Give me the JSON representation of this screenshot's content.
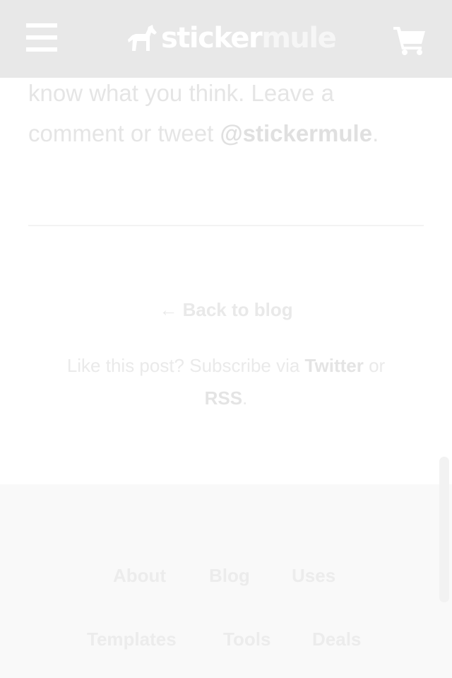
{
  "header": {
    "logo_primary": "sticker",
    "logo_secondary": "mule",
    "menu_icon": "hamburger-icon",
    "cart_icon": "cart-icon",
    "logo_icon": "mule-icon"
  },
  "article": {
    "line_1": "know what you think. Leave a",
    "line_2_prefix": "comment or tweet ",
    "handle": "@stickermule",
    "line_2_suffix": "."
  },
  "post_footer": {
    "back_arrow": "←",
    "back_label": "Back to blog",
    "subscribe_prefix": "Like this post? Subscribe via ",
    "twitter_label": "Twitter",
    "subscribe_or": " or",
    "rss_label": "RSS",
    "subscribe_suffix": "."
  },
  "footer": {
    "links": [
      "About",
      "Blog",
      "Uses",
      "Templates",
      "Tools",
      "Deals"
    ]
  },
  "colors": {
    "header_bg": "#e8e8e8",
    "footer_bg": "#f9f9f9",
    "text_faded": "#e5e5e5"
  }
}
